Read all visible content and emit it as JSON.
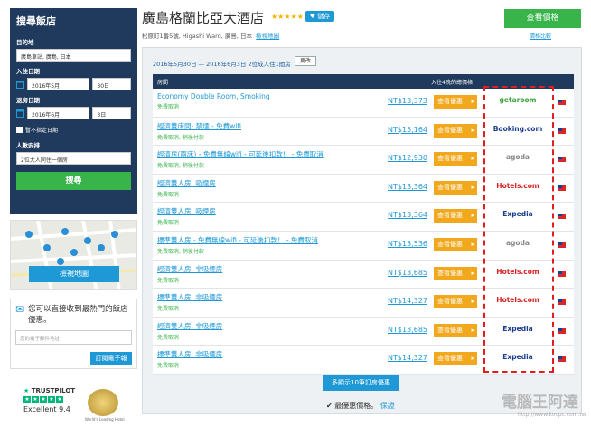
{
  "sidebar": {
    "title": "搜尋飯店",
    "destination_label": "目的地",
    "destination_value": "廣島車站, 廣島, 日本",
    "checkin_label": "入住日期",
    "checkin_month": "2016年5月",
    "checkin_day": "30日",
    "checkout_label": "退房日期",
    "checkout_month": "2016年6月",
    "checkout_day": "3日",
    "no_dates_label": "暫不指定日期",
    "guests_label": "人數安排",
    "guests_value": "2位大人同住一個房",
    "search_button": "搜尋",
    "map_button": "檢視地圖",
    "email_heading": "您可以直接收到最熱門的飯店優惠。",
    "email_placeholder": "您的電子郵件地址",
    "subscribe_button": "訂閱電子報",
    "trust_brand": "TRUSTPILOT",
    "trust_score": "Excellent 9.4",
    "award_text": "World's Leading Hotel"
  },
  "header": {
    "hotel_name": "廣島格蘭比亞大酒店",
    "stars": "★★★★★",
    "save_button": "♥ 儲存",
    "address": "松原町1番5號, Higashi Ward, 廣島, 日本",
    "map_link": "檢視地圖",
    "price_button": "查看價格",
    "price_link": "價格比較"
  },
  "results": {
    "date_line": "2016年5月30日 — 2016年6月3日 2位成人住1間房",
    "change_button": "更改",
    "col_room": "房間",
    "col_price": "入住4晚的總價格",
    "deal_label": "查看優惠",
    "rows": [
      {
        "name": "Economy Double Room, Smoking",
        "note": "免費取消",
        "price": "NT$13,373",
        "provider": "getaroom"
      },
      {
        "name": "經濟雙床間- 禁煙 - 免費wifi",
        "note": "免費取消, 稍後付款",
        "price": "NT$15,164",
        "provider": "Booking.com"
      },
      {
        "name": "經濟房(兩床) - 免費無線wifi - 可延後扣款！ - 免費取消",
        "note": "免費取消, 稍後付款",
        "price": "NT$12,930",
        "provider": "agoda"
      },
      {
        "name": "經濟雙人房, 吸煙房",
        "note": "免費取消",
        "price": "NT$13,364",
        "provider": "Hotels.com"
      },
      {
        "name": "經濟雙人房, 吸煙房",
        "note": "免費取消",
        "price": "NT$13,364",
        "provider": "Expedia"
      },
      {
        "name": "標準雙人房 - 免費無線wifi - 可延後扣款！ - 免費取消",
        "note": "免費取消, 稍後付款",
        "price": "NT$13,536",
        "provider": "agoda"
      },
      {
        "name": "經濟雙人房, 非吸煙房",
        "note": "免費取消",
        "price": "NT$13,685",
        "provider": "Hotels.com"
      },
      {
        "name": "標準雙人房, 非吸煙房",
        "note": "免費取消",
        "price": "NT$14,327",
        "provider": "Hotels.com"
      },
      {
        "name": "經濟雙人房, 非吸煙房",
        "note": "免費取消",
        "price": "NT$13,685",
        "provider": "Expedia"
      },
      {
        "name": "標準雙人房, 非吸煙房",
        "note": "免費取消",
        "price": "NT$14,327",
        "provider": "Expedia"
      }
    ],
    "more_button": "多顯示10筆訂房優惠",
    "best_price_text": "最優惠價格。",
    "best_price_link": "保證"
  },
  "watermark": {
    "text": "電腦王阿達",
    "url": "http://www.kocpc.com.tw"
  }
}
